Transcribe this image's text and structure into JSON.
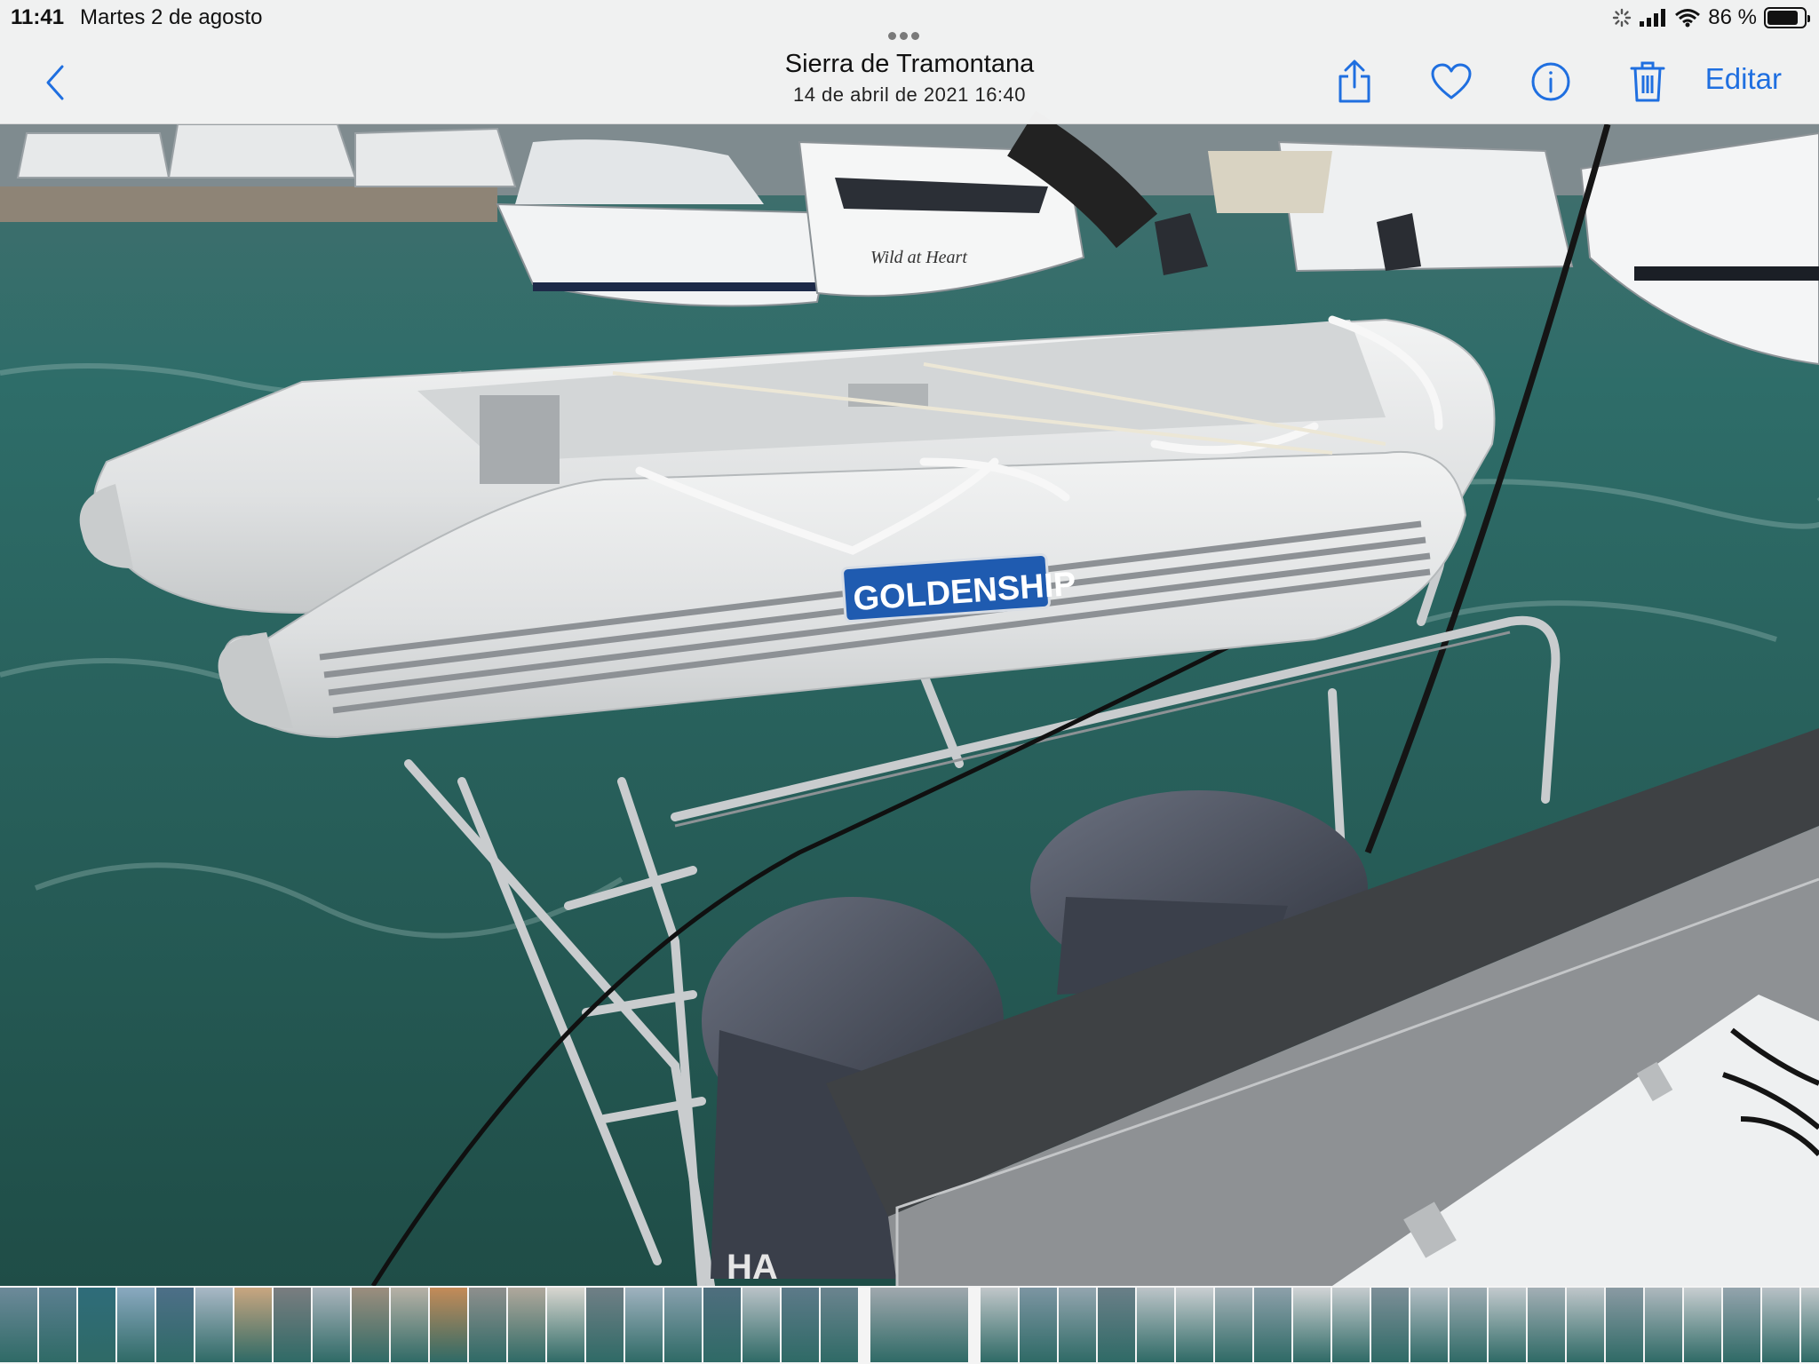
{
  "status_bar": {
    "time": "11:41",
    "date": "Martes 2 de agosto",
    "battery_text": "86 %",
    "battery_level": 0.86
  },
  "header": {
    "title": "Sierra de Tramontana",
    "subtitle": "14 de abril de 2021  16:40",
    "edit_label": "Editar",
    "accent_color": "#1f6fe0"
  },
  "photo": {
    "logo_text": "GOLDENSHIP",
    "boat_name": "Wild at Heart"
  },
  "thumbnail_strip": {
    "colors": [
      "#6d8a9a",
      "#5b7f90",
      "#2f6c7a",
      "#8aa9c0",
      "#4d6f88",
      "#a9b8c6",
      "#c9a680",
      "#7a7d80",
      "#aab4bc",
      "#9c8e7e",
      "#b7b1a6",
      "#c48b58",
      "#8e8f8d",
      "#b0a89c",
      "#d8d6d0",
      "#707f86",
      "#9fb2bf",
      "#87a0ad",
      "#4f6e7e",
      "#b9c2c7",
      "#5d7a89",
      "#6b848f",
      "#a0a8ae",
      "#c0c6c9",
      "#7c95a2",
      "#93a5af",
      "#6a7f88",
      "#bcc4c8",
      "#c9ced1",
      "#a7b3ba",
      "#8da0aa",
      "#d0d3d5",
      "#c5cbce",
      "#7d8f98",
      "#b3bec4",
      "#9eacb3",
      "#c2c9cd",
      "#a3afb5",
      "#bfc6ca",
      "#8a9aa3",
      "#aeb8be",
      "#c7cdd0",
      "#94a4ad",
      "#b8c1c6",
      "#c1c8cb",
      "#7e929c",
      "#a9b5bb",
      "#cbd0d3",
      "#9aaab2",
      "#b4bec3",
      "#8798a1",
      "#c3cacd",
      "#a6b2b8",
      "#3f7fa6",
      "#d7a548",
      "#7e8a90"
    ],
    "selected_index": 22
  }
}
